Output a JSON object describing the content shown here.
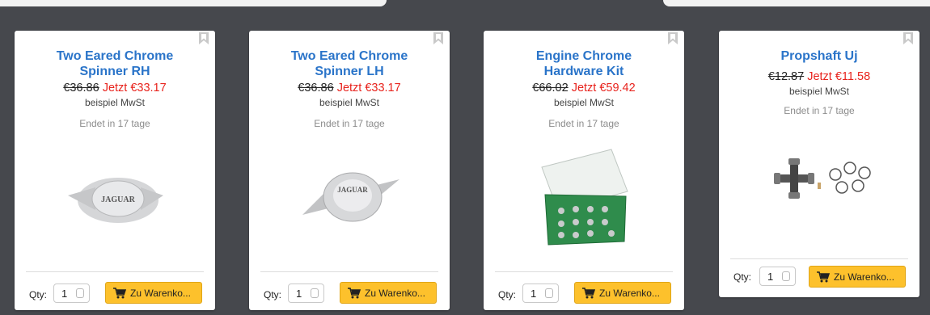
{
  "products": [
    {
      "title_line1": "Two Eared Chrome",
      "title_line2": "Spinner RH",
      "old_price": "€36.86",
      "new_price": "Jetzt €33.17",
      "tax_note": "beispiel MwSt",
      "ends": "Endet in 17 tage",
      "qty_label": "Qty:",
      "qty": "1",
      "cart_label": "Zu Warenko..."
    },
    {
      "title_line1": "Two Eared Chrome",
      "title_line2": "Spinner LH",
      "old_price": "€36.86",
      "new_price": "Jetzt €33.17",
      "tax_note": "beispiel MwSt",
      "ends": "Endet in 17 tage",
      "qty_label": "Qty:",
      "qty": "1",
      "cart_label": "Zu Warenko..."
    },
    {
      "title_line1": "Engine Chrome",
      "title_line2": "Hardware Kit",
      "old_price": "€66.02",
      "new_price": "Jetzt €59.42",
      "tax_note": "beispiel MwSt",
      "ends": "Endet in 17 tage",
      "qty_label": "Qty:",
      "qty": "1",
      "cart_label": "Zu Warenko..."
    },
    {
      "title_line1": "Propshaft Uj",
      "title_line2": "",
      "old_price": "€12.87",
      "new_price": "Jetzt €11.58",
      "tax_note": "beispiel MwSt",
      "ends": "Endet in 17 tage",
      "qty_label": "Qty:",
      "qty": "1",
      "cart_label": "Zu Warenko..."
    }
  ],
  "colors": {
    "background": "#46484d",
    "title": "#2a74c9",
    "sale_price": "#e8231d",
    "cart_button": "#fdc12c"
  }
}
